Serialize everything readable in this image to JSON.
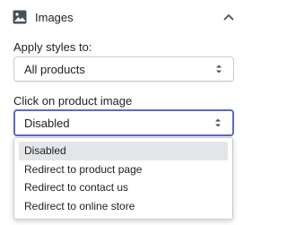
{
  "section": {
    "title": "Images",
    "icon": "image-icon",
    "toggle_icon": "chevron-up-icon"
  },
  "apply_styles": {
    "label": "Apply styles to:",
    "value": "All products"
  },
  "click_image": {
    "label": "Click on product image",
    "value": "Disabled",
    "options": [
      "Disabled",
      "Redirect to product page",
      "Redirect to contact us",
      "Redirect to online store"
    ]
  },
  "colors": {
    "focus_border": "#5c6ac4",
    "text": "#202223",
    "border": "#c4cdd5",
    "highlight": "#e3e5e7"
  }
}
